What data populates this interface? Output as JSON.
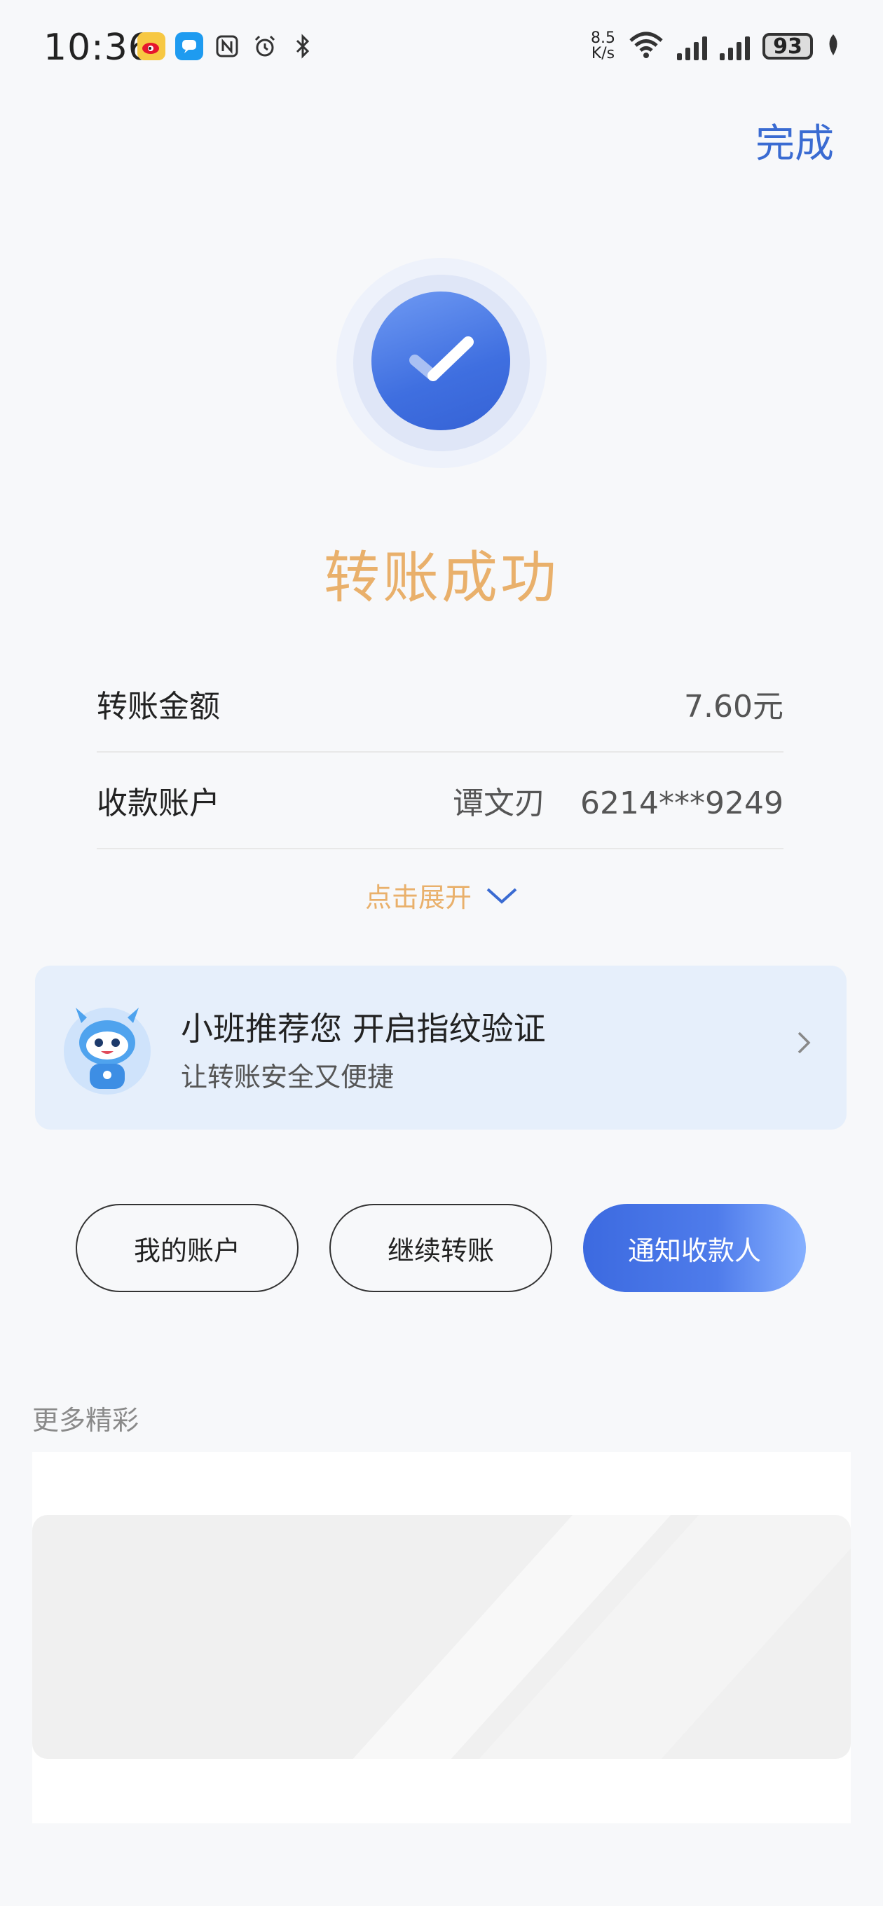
{
  "status_bar": {
    "time": "10:36",
    "net_speed_value": "8.5",
    "net_speed_unit": "K/s",
    "battery": "93",
    "icons": [
      "weibo-icon",
      "message-icon",
      "nfc-icon",
      "alarm-icon",
      "bluetooth-icon",
      "wifi-icon",
      "signal-icon",
      "signal-icon",
      "battery-icon",
      "leaf-icon"
    ]
  },
  "header": {
    "done_label": "完成"
  },
  "result": {
    "title": "转账成功"
  },
  "details": [
    {
      "label": "转账金额",
      "value": "7.60元"
    },
    {
      "label": "收款账户",
      "name": "谭文刃",
      "value": "6214***9249"
    }
  ],
  "expand_label": "点击展开",
  "banner": {
    "title": "小班推荐您 开启指纹验证",
    "subtitle": "让转账安全又便捷"
  },
  "actions": {
    "my_account": "我的账户",
    "continue_transfer": "继续转账",
    "notify_payee": "通知收款人"
  },
  "more": {
    "title": "更多精彩"
  },
  "colors": {
    "accent": "#3a6bd2",
    "gold": "#e9b06b",
    "banner_bg": "#e6effb"
  }
}
